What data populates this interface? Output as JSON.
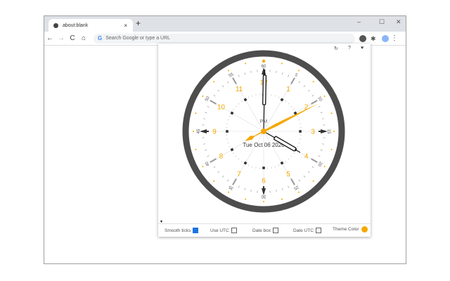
{
  "browser": {
    "tab_title": "about:blank",
    "omnibox_placeholder": "Search Google or type a URL",
    "new_tab": "+",
    "close_tab": "×",
    "minimize": "–",
    "maximize": "☐",
    "close": "✕",
    "back": "←",
    "forward": "→",
    "reload": "C",
    "home": "⌂",
    "menu": "⋮"
  },
  "popup": {
    "refresh": "↻",
    "help": "?",
    "heart": "♥",
    "collapse": "▾",
    "clock": {
      "hour": 4,
      "minute": 0,
      "second": 10.5,
      "ampm": "PM",
      "date": "Tue Oct 06 2020",
      "hour_labels": [
        "12",
        "1",
        "2",
        "3",
        "4",
        "5",
        "6",
        "7",
        "8",
        "9",
        "10",
        "11"
      ],
      "minute_labels": [
        "60",
        "5",
        "10",
        "15",
        "20",
        "25",
        "30",
        "35",
        "40",
        "45",
        "50",
        "55"
      ],
      "theme_color": "#f5a800",
      "ring_color": "#4d4d4d"
    },
    "options": [
      {
        "label": "Smooth ticks",
        "checked": true
      },
      {
        "label": "Use UTC",
        "checked": false
      },
      {
        "label": "Date box",
        "checked": false
      },
      {
        "label": "Date UTC",
        "checked": false
      }
    ],
    "theme_label": "Theme Color"
  }
}
